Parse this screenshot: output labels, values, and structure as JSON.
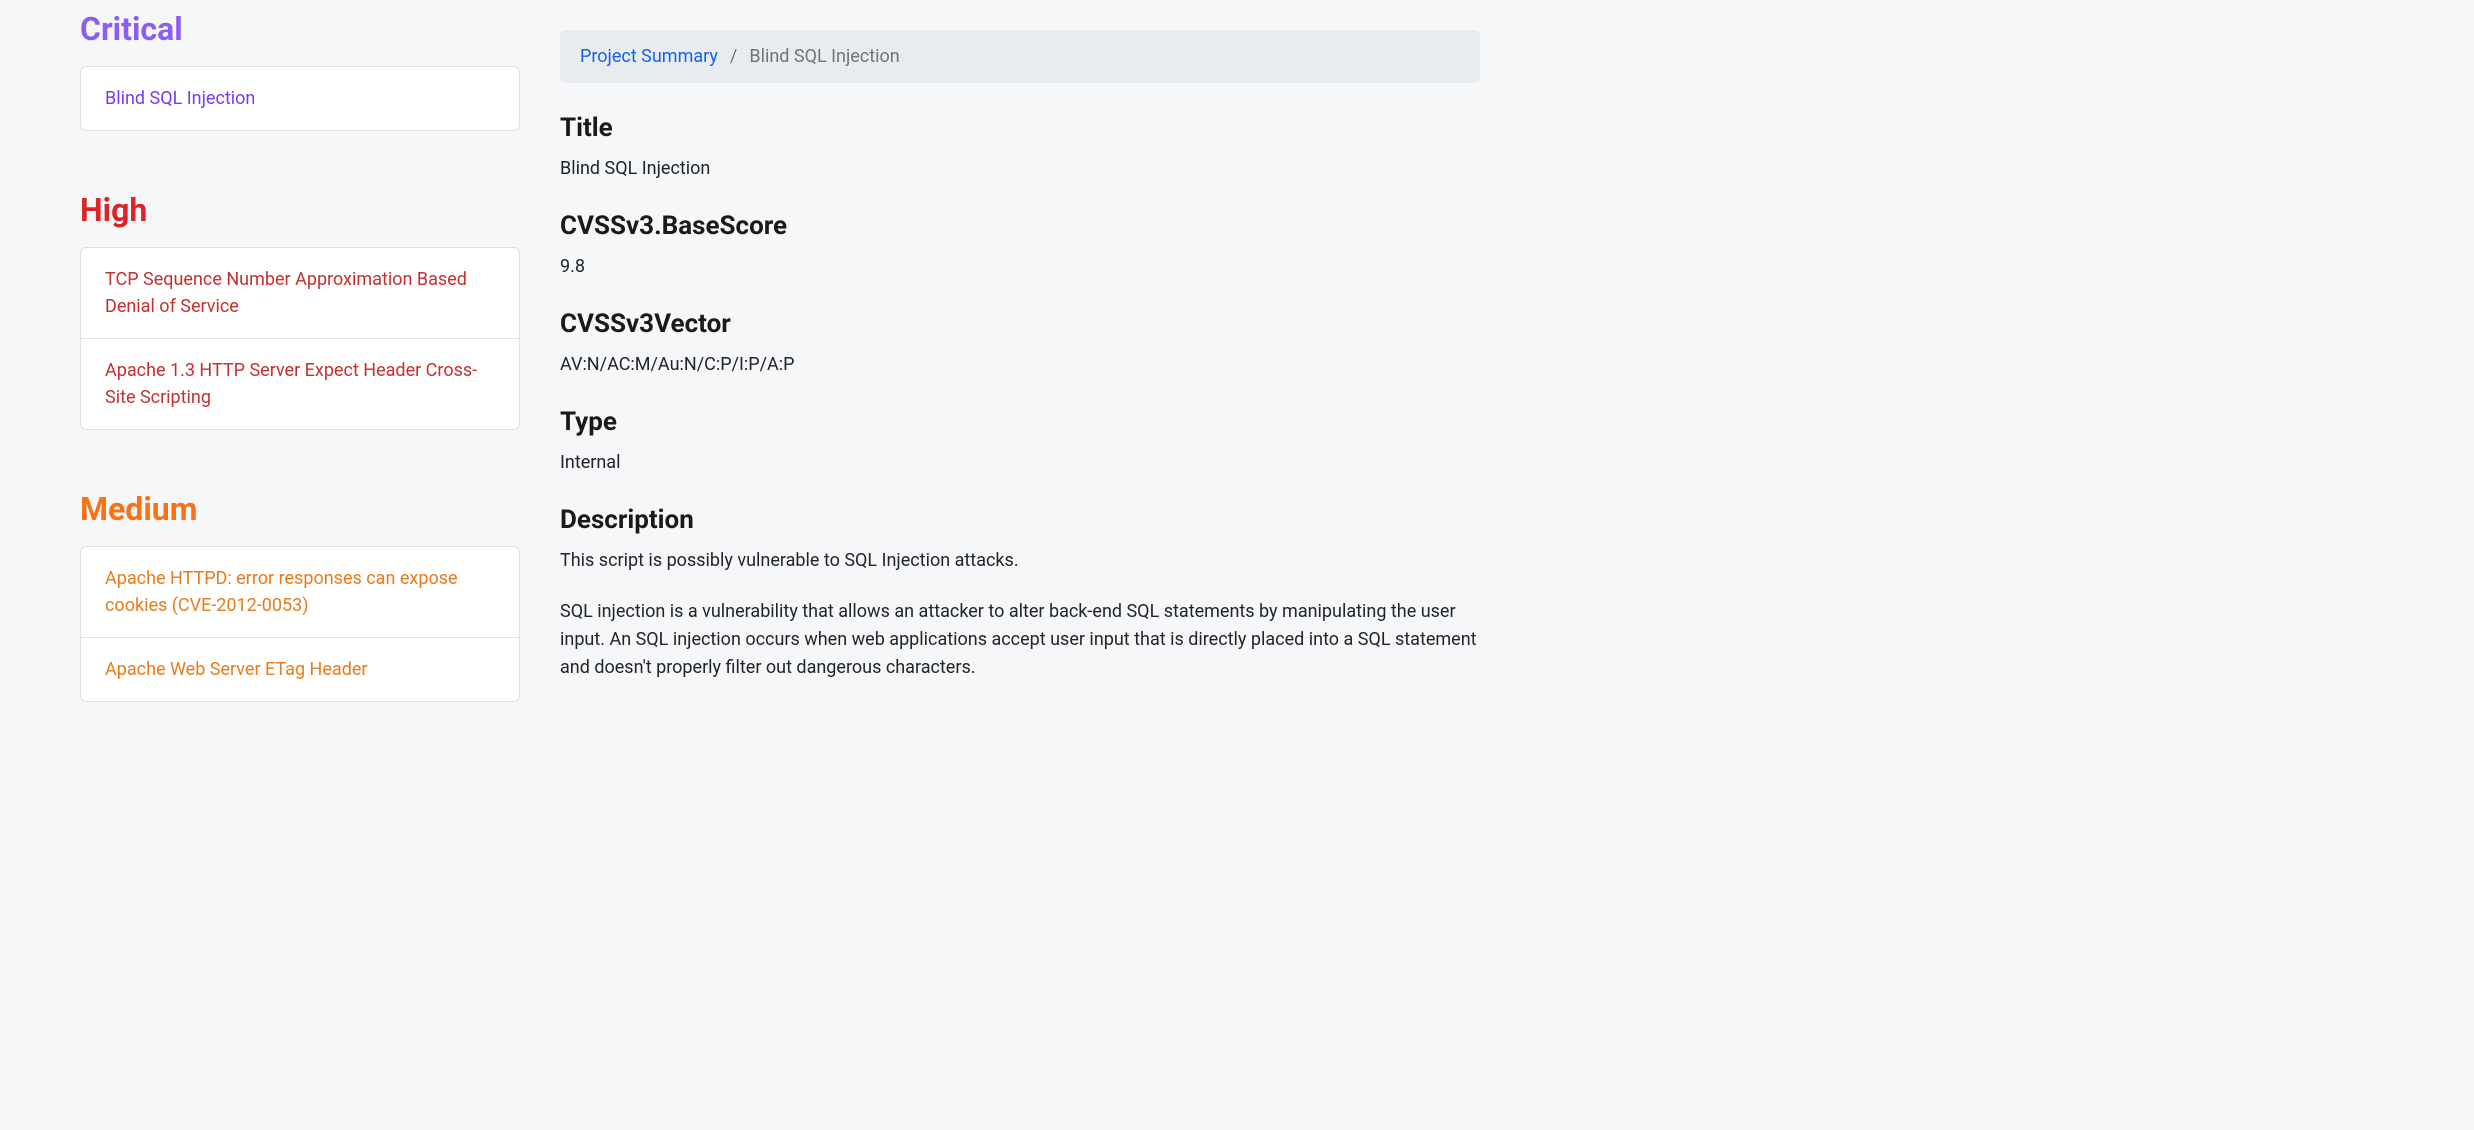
{
  "sidebar": {
    "sections": [
      {
        "heading": "Critical",
        "severity": "critical",
        "items": [
          "Blind SQL Injection"
        ]
      },
      {
        "heading": "High",
        "severity": "high",
        "items": [
          "TCP Sequence Number Approximation Based Denial of Service",
          "Apache 1.3 HTTP Server Expect Header Cross-Site Scripting"
        ]
      },
      {
        "heading": "Medium",
        "severity": "medium",
        "items": [
          "Apache HTTPD: error responses can expose cookies (CVE-2012-0053)",
          "Apache Web Server ETag Header"
        ]
      }
    ]
  },
  "breadcrumb": {
    "link": "Project Summary",
    "sep": "/",
    "current": "Blind SQL Injection"
  },
  "detail": {
    "title_label": "Title",
    "title_value": "Blind SQL Injection",
    "basescore_label": "CVSSv3.BaseScore",
    "basescore_value": "9.8",
    "vector_label": "CVSSv3Vector",
    "vector_value": "AV:N/AC:M/Au:N/C:P/I:P/A:P",
    "type_label": "Type",
    "type_value": "Internal",
    "description_label": "Description",
    "description_p1": "This script is possibly vulnerable to SQL Injection attacks.",
    "description_p2": "SQL injection is a vulnerability that allows an attacker to alter back-end SQL statements by manipulating the user input. An SQL injection occurs when web applications accept user input that is directly placed into a SQL statement and doesn't properly filter out dangerous characters."
  }
}
